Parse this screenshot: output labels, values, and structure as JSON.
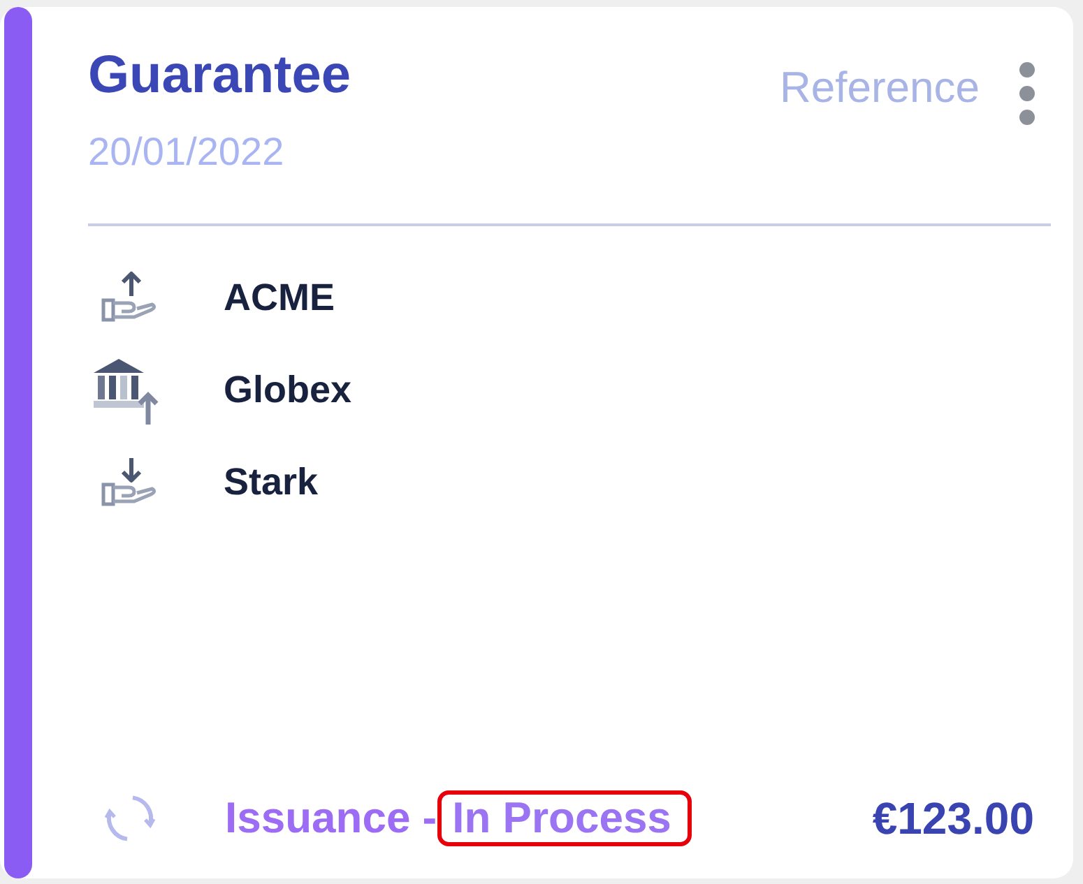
{
  "header": {
    "title": "Guarantee",
    "date": "20/01/2022",
    "reference_label": "Reference"
  },
  "parties": [
    {
      "kind": "send",
      "name": "ACME"
    },
    {
      "kind": "bank",
      "name": "Globex"
    },
    {
      "kind": "receive",
      "name": "Stark"
    }
  ],
  "footer": {
    "stage": "Issuance -",
    "status": {
      "text": "In Process",
      "highlighted": true
    },
    "amount": "€123.00"
  }
}
